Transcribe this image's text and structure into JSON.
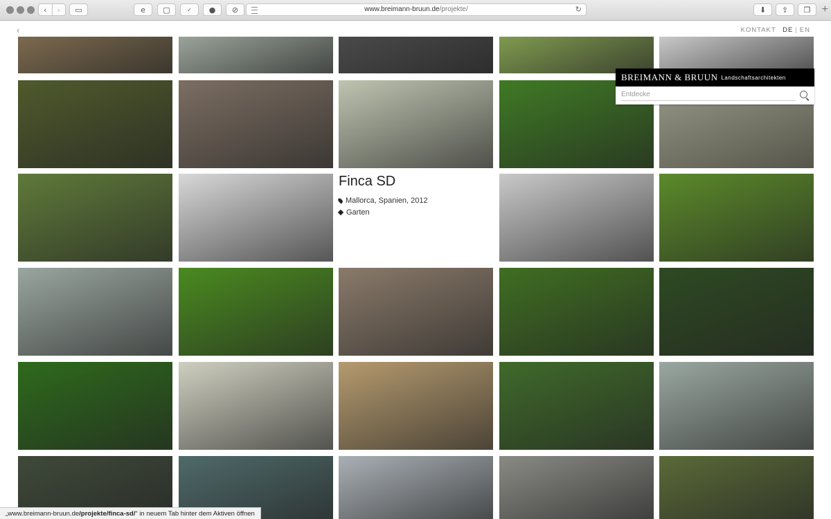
{
  "browser": {
    "url_host": "www.breimann-bruun.de",
    "url_path": "/projekte/",
    "new_tab_symbol": "+",
    "icons": [
      "back-icon",
      "forward-icon",
      "sidebar-icon",
      "ie-icon",
      "tabs-icon",
      "w3c-icon",
      "pinterest-icon",
      "block-icon",
      "reader-icon",
      "reload-icon",
      "download-icon",
      "share-icon",
      "tab-overview-icon"
    ]
  },
  "page": {
    "back_arrow": "‹",
    "nav": {
      "contact": "KONTAKT",
      "lang_de": "DE",
      "separator": "|",
      "lang_en": "EN"
    }
  },
  "brand": {
    "name": "BREIMANN & BRUUN",
    "subtitle": "Landschaftsarchitekten",
    "search_placeholder": "Entdecke"
  },
  "project_info": {
    "title": "Finca SD",
    "location": "Mallorca, Spanien, 2012",
    "category": "Garten"
  },
  "status_bar": {
    "quote_open": "„",
    "host": "www.breimann-bruun.de",
    "path": "/projekte/finca-sd/",
    "suffix": "“ in neuem Tab hinter dem Aktiven öffnen"
  },
  "tile_colors": {
    "r0": [
      "#7c6a4e",
      "#9aa39a",
      "#4a4a4a",
      "#7f9a4f",
      "#c8c8c8"
    ],
    "r1": [
      "#4f5a2c",
      "#7c6e62",
      "#bfc4b0",
      "#3f7a24",
      null
    ],
    "r2": [
      "#5f7a3a",
      "#d8d8d8",
      null,
      "#c9c9c9",
      "#5b8a2a"
    ],
    "r3": [
      "#9aa6a0",
      "#4a8a20",
      "#8a7a6a",
      "#3f6e22",
      "#2e4a22"
    ],
    "r4": [
      "#2e6a1c",
      "#cfcfc0",
      "#b59a6e",
      "#3f6a2a",
      "#9aa7a0"
    ],
    "r5": [
      "#3f4a3a",
      "#4f6a6a",
      "#a9b0b5",
      "#8a8a85",
      "#5a6a38"
    ]
  }
}
